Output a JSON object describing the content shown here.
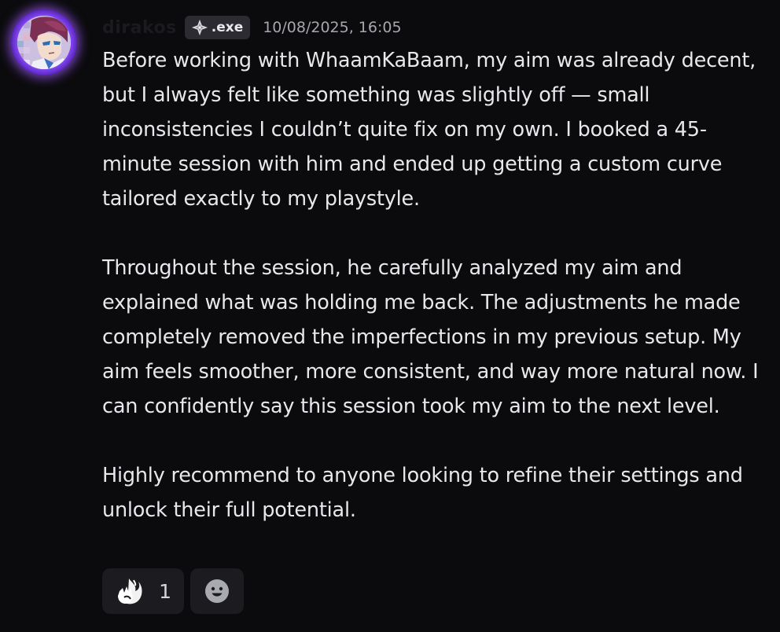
{
  "message": {
    "author": {
      "username": "dirakos",
      "tag_label": ".exe",
      "tag_icon": "diamond-sparkle-icon",
      "avatar": "anime-character-avatar"
    },
    "timestamp": "10/08/2025, 16:05",
    "paragraphs": [
      "Before working with WhaamKaBaam, my aim was already decent, but I always felt like something was slightly off — small inconsistencies I couldn’t quite fix on my own. I booked a 45-minute session with him and ended up getting a custom curve tailored exactly to my playstyle.",
      "Throughout the session, he carefully analyzed my aim and explained what was holding me back. The adjustments he made completely removed the imperfections in my previous setup. My aim feels smoother, more consistent, and way more natural now. I can confidently say this session took my aim to the next level.",
      "Highly recommend to anyone looking to refine their settings and unlock their full potential."
    ],
    "reactions": [
      {
        "emoji": "fire-hand-icon",
        "count": "1"
      }
    ],
    "add_reaction_icon": "smiley-icon"
  },
  "colors": {
    "background": "#0b0b0d",
    "text": "#e8e8ec",
    "timestamp": "#a6a6ad",
    "tag_bg": "#2b2b31",
    "reaction_bg": "#1b1b20",
    "avatar_glow": "#a05aff"
  }
}
